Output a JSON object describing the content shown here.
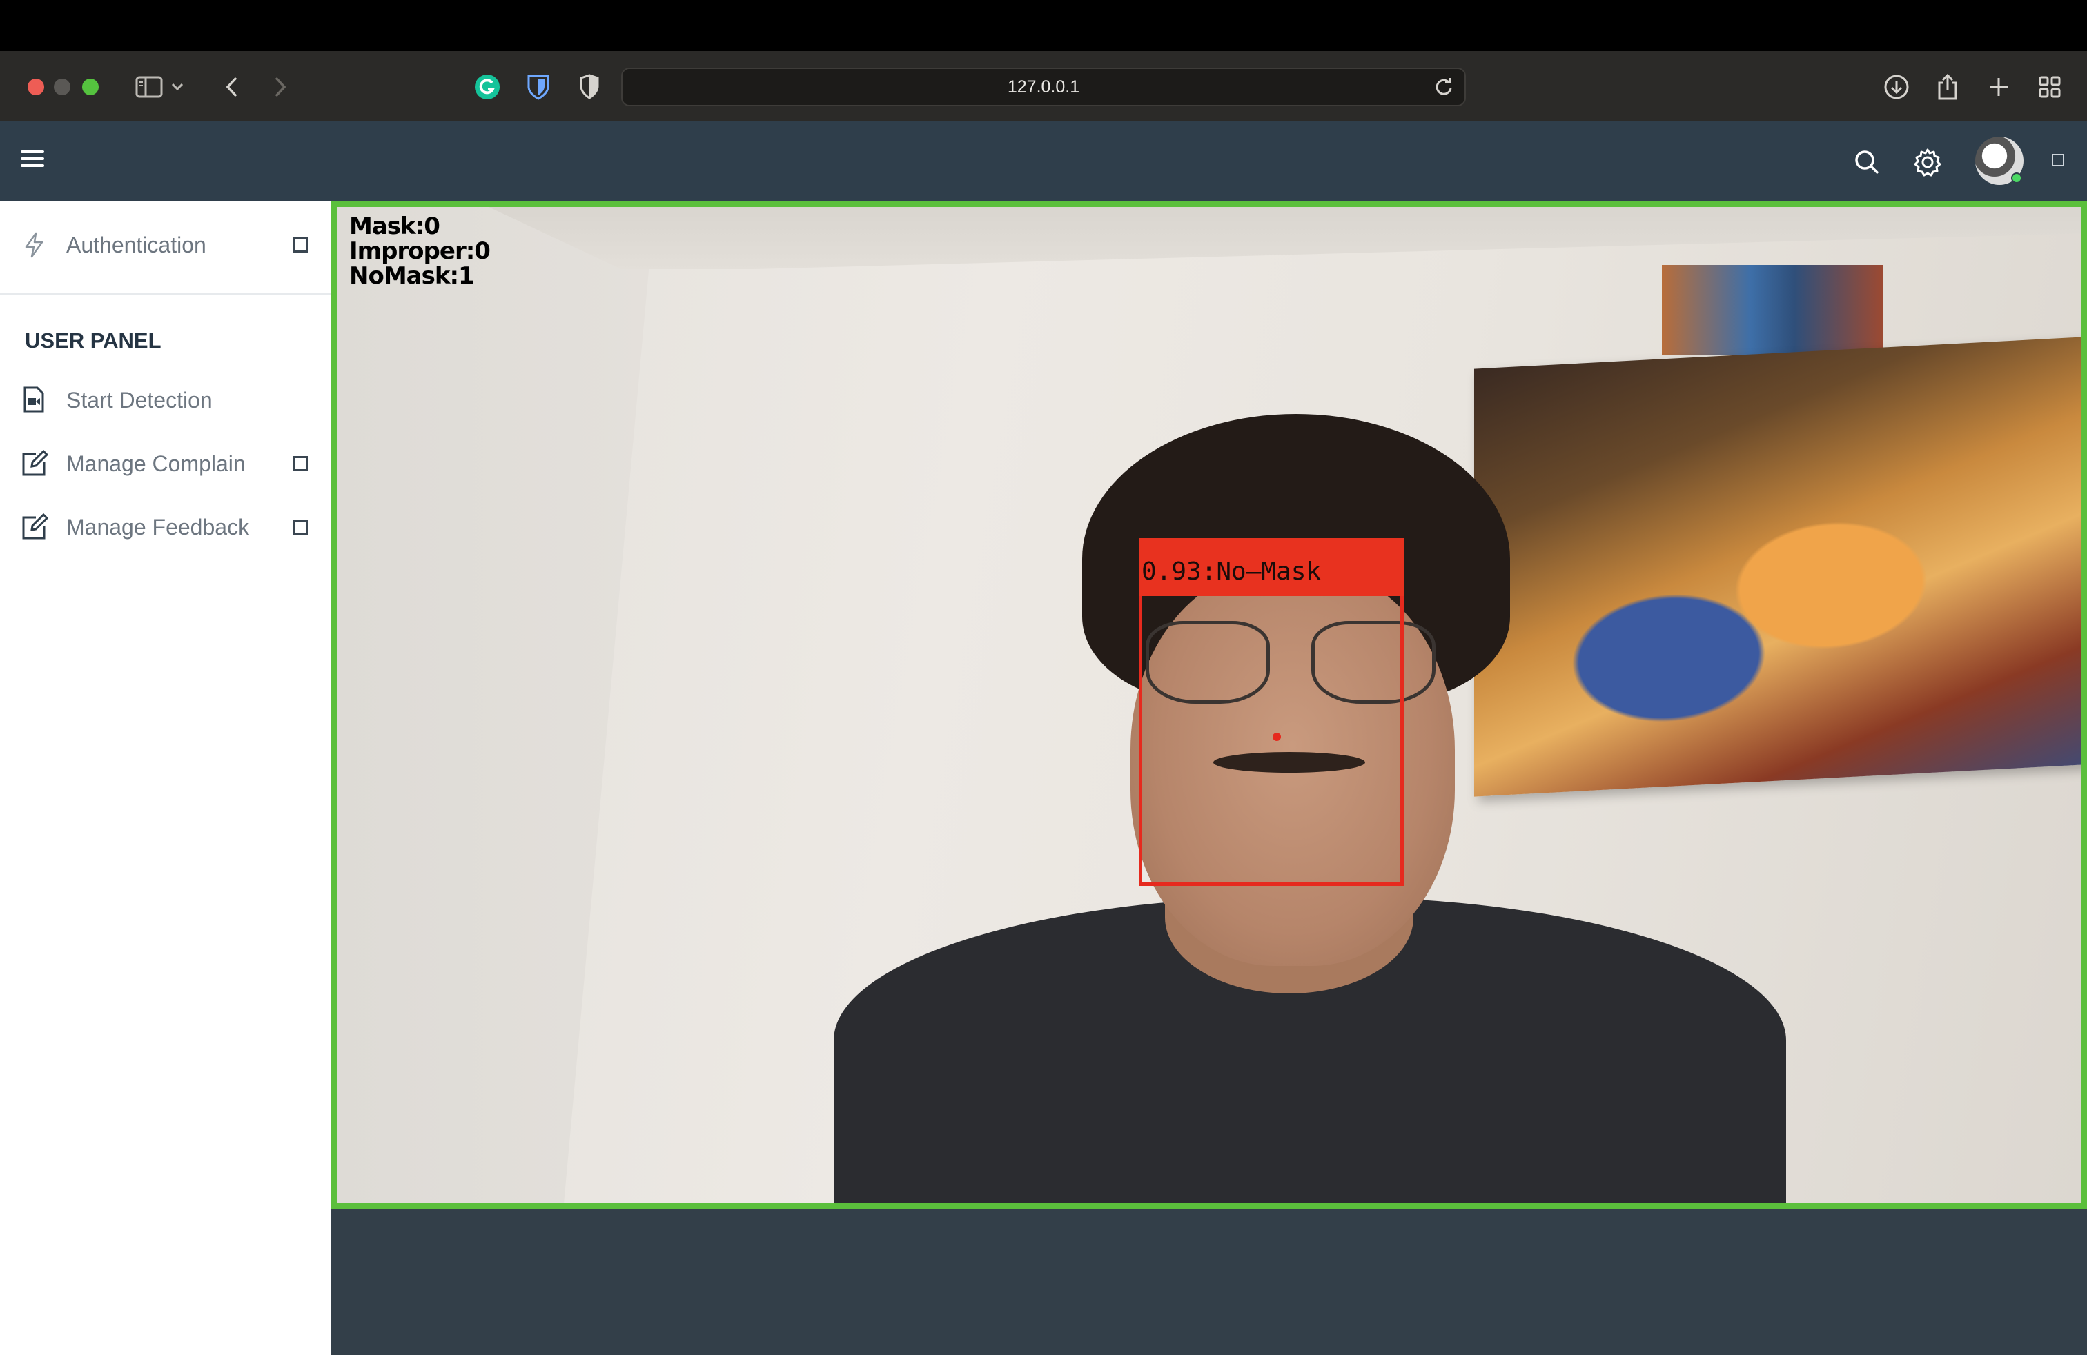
{
  "browser": {
    "url": "127.0.0.1"
  },
  "sidebar": {
    "items_top": [
      {
        "label": "Authentication",
        "icon": "lightning-icon",
        "has_toggle": true
      }
    ],
    "section_heading": "USER PANEL",
    "items": [
      {
        "label": "Start Detection",
        "icon": "video-file-icon",
        "has_toggle": false
      },
      {
        "label": "Manage Complain",
        "icon": "edit-icon",
        "has_toggle": true
      },
      {
        "label": "Manage Feedback",
        "icon": "edit-icon",
        "has_toggle": true
      }
    ]
  },
  "video": {
    "counters": {
      "mask": "Mask:0",
      "improper": "Improper:0",
      "nomask": "NoMask:1"
    },
    "detection_label": "0.93:No—Mask"
  },
  "colors": {
    "header_bg": "#2f3e4b",
    "frame_border": "#5bbf3c",
    "detection_red": "#e8321f",
    "heading_text": "#253443",
    "sidebar_text": "#6d7680"
  }
}
